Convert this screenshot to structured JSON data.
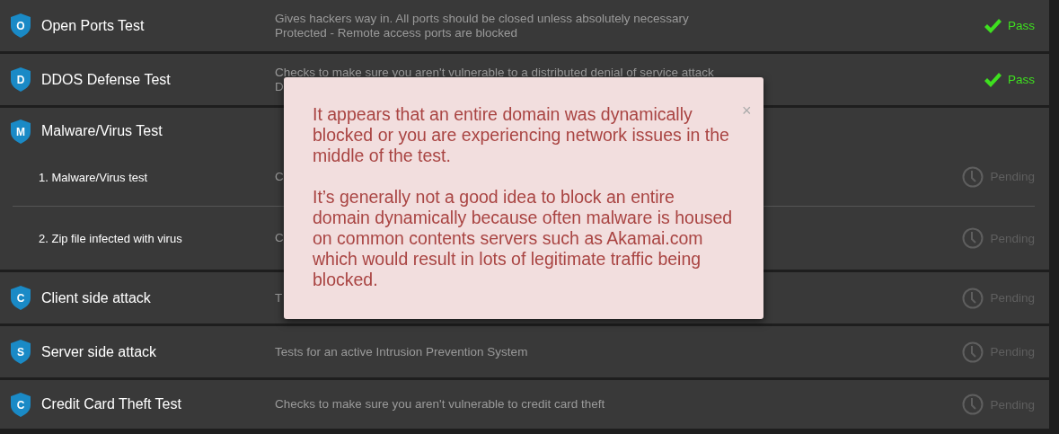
{
  "tests": [
    {
      "letter": "O",
      "name": "Open Ports Test",
      "description": [
        "Gives hackers way in. All ports should be closed unless absolutely necessary",
        "Protected - Remote access ports are blocked"
      ],
      "status": {
        "kind": "pass",
        "label": "Pass"
      }
    },
    {
      "letter": "D",
      "name": "DDOS Defense Test",
      "description": [
        "Checks to make sure you aren't vulnerable to a distributed denial of service attack",
        "D"
      ],
      "status": {
        "kind": "pass",
        "label": "Pass"
      }
    },
    {
      "letter": "M",
      "name": "Malware/Virus Test",
      "subtests": [
        {
          "name": "1. Malware/Virus test",
          "description": [
            "C"
          ],
          "status": {
            "kind": "pending",
            "label": "Pending"
          }
        },
        {
          "name": "2. Zip file infected with virus",
          "description": [
            "C"
          ],
          "status": {
            "kind": "pending",
            "label": "Pending"
          }
        }
      ]
    },
    {
      "letter": "C",
      "name": "Client side attack",
      "description": [
        "T"
      ],
      "status": {
        "kind": "pending",
        "label": "Pending"
      }
    },
    {
      "letter": "S",
      "name": "Server side attack",
      "description": [
        "Tests for an active Intrusion Prevention System"
      ],
      "status": {
        "kind": "pending",
        "label": "Pending"
      }
    },
    {
      "letter": "C",
      "name": "Credit Card Theft Test",
      "description": [
        "Checks to make sure you aren't vulnerable to credit card theft"
      ],
      "status": {
        "kind": "pending",
        "label": "Pending"
      }
    }
  ],
  "alert": {
    "close": "×",
    "paragraphs": [
      "It appears that an entire domain was dynamically blocked or you are experiencing network issues in the middle of the test.",
      "It’s generally not a good idea to block an entire domain dynamically because often malware is housed on common contents servers such as Akamai.com which would result in lots of legitimate traffic being blocked."
    ]
  }
}
